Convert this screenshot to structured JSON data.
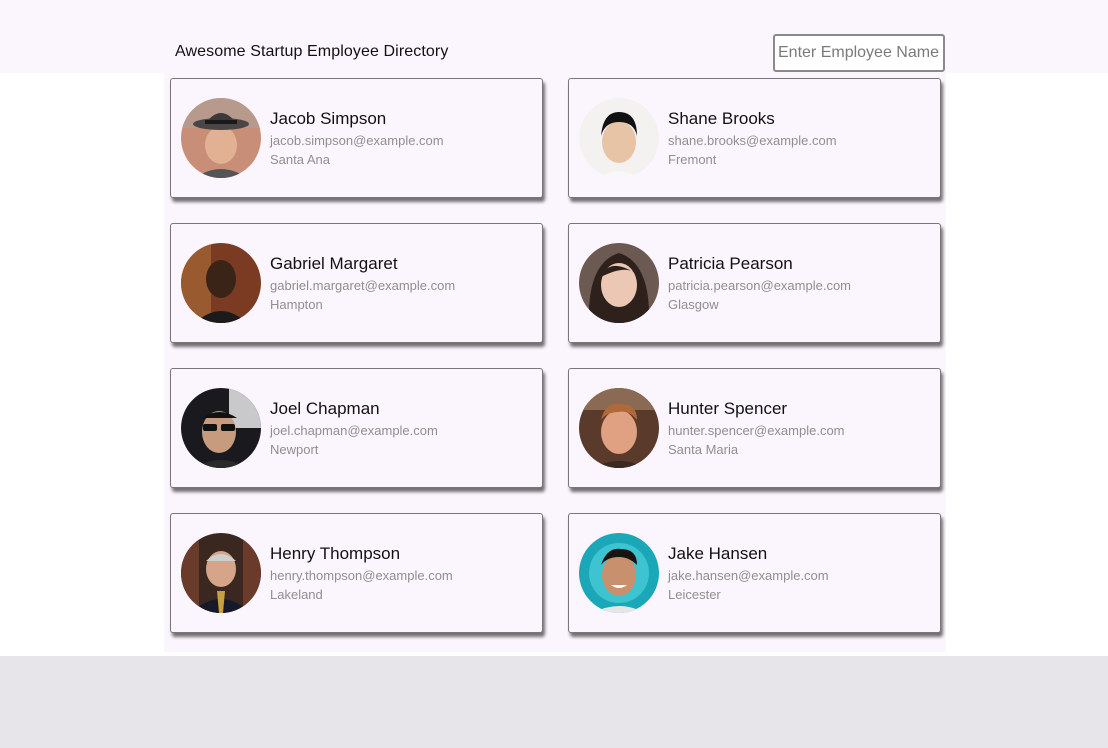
{
  "header": {
    "title": "Awesome Startup Employee Directory"
  },
  "search": {
    "placeholder": "Enter Employee Name",
    "value": ""
  },
  "employees": [
    {
      "name": "Jacob Simpson",
      "email": "jacob.simpson@example.com",
      "city": "Santa Ana"
    },
    {
      "name": "Shane Brooks",
      "email": "shane.brooks@example.com",
      "city": "Fremont"
    },
    {
      "name": "Gabriel Margaret",
      "email": "gabriel.margaret@example.com",
      "city": "Hampton"
    },
    {
      "name": "Patricia Pearson",
      "email": "patricia.pearson@example.com",
      "city": "Glasgow"
    },
    {
      "name": "Joel Chapman",
      "email": "joel.chapman@example.com",
      "city": "Newport"
    },
    {
      "name": "Hunter Spencer",
      "email": "hunter.spencer@example.com",
      "city": "Santa Maria"
    },
    {
      "name": "Henry Thompson",
      "email": "henry.thompson@example.com",
      "city": "Lakeland"
    },
    {
      "name": "Jake Hansen",
      "email": "jake.hansen@example.com",
      "city": "Leicester"
    }
  ]
}
